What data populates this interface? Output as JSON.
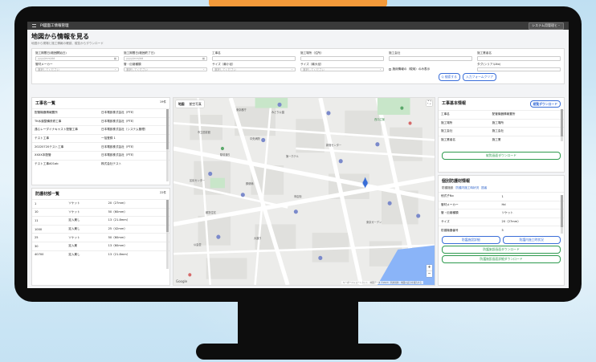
{
  "app": {
    "name": "PI図面工情報管理",
    "system_button": "システム用管理ヒ・"
  },
  "page": {
    "title": "地図から情報を見る",
    "subtitle": "地図から現場と施工情報の確認、縦覧からダウンロード"
  },
  "filters": {
    "row1": [
      {
        "label": "施工期間日(範囲開始日)",
        "value": "yyyy/mm/dd",
        "icon": "calendar-icon"
      },
      {
        "label": "施工期間日(範囲終了日)",
        "value": "yyyy/mm/dd",
        "icon": "calendar-icon"
      },
      {
        "label": "工事名",
        "value": ""
      },
      {
        "label": "施工場所（住所）",
        "value": ""
      },
      {
        "label": "施工会社",
        "value": ""
      },
      {
        "label": "施工業者名",
        "value": ""
      }
    ],
    "row2": [
      {
        "label": "管材メーカー",
        "value": "選択してください"
      },
      {
        "label": "管・伝継種類",
        "value": "選択してください"
      },
      {
        "label": "サイズ（最小径）",
        "value": "選択してください"
      },
      {
        "label": "サイズ（最大径）",
        "value": "選択してください"
      },
      {
        "label": "",
        "value": "",
        "checkbox": "施用情報の（現用）のみ表示"
      },
      {
        "label": "タグ(シリアルNo)",
        "value": ""
      }
    ],
    "search_button": "Q 検索する",
    "clear_button": "入力フォームクリア"
  },
  "project_list": {
    "title": "工事名一覧",
    "count": "19件",
    "rows": [
      [
        "配管機器情報置所",
        "日本電設株式会社（PTE）"
      ],
      [
        "TK水道整備改修工事",
        "日本電設株式会社（PTE）"
      ],
      [
        "遠心レーダイナキャスト配管工事",
        "日本電設株式会社（システム管理）"
      ],
      [
        "テスト工事",
        "一括登録 1"
      ],
      [
        "20220720テスト工事",
        "日本電設株式会社（PTE）"
      ],
      [
        "XXXX本配管",
        "日本電設株式会社（PTE）"
      ],
      [
        "テスト工事A01ab",
        "株式会社テスト"
      ]
    ]
  },
  "material_list": {
    "title": "防護材部一覧",
    "count": "22件",
    "rows": [
      [
        "1",
        "ソケット",
        "20（27mm）"
      ],
      [
        "10",
        "ソケット",
        "50（60mm）"
      ],
      [
        "11",
        "定入巣し",
        "13（21.8mm）"
      ],
      [
        "1000",
        "定入巣し",
        "25（42mm）"
      ],
      [
        "25",
        "ソケット",
        "50（60mm）"
      ],
      [
        "30",
        "定入巣",
        "13（60mm）"
      ],
      [
        "40700",
        "定入巣し",
        "13（21.8mm）"
      ]
    ]
  },
  "map": {
    "tab_map": "地図",
    "tab_satellite": "航空写真",
    "zoom_in": "+",
    "zoom_out": "−",
    "logo": "Google",
    "footer": "キーボードショートカット　地図データ ©2023　利用規約　地図の誤りを報告する",
    "labels": [
      "東京都庁",
      "みどり公園",
      "市立図書館",
      "中央病院",
      "駅前通り",
      "第一ホテル",
      "区民センター",
      "郵便局",
      "商店街",
      "都営住宅",
      "西口広場",
      "東京ガーデン",
      "大通り",
      "新宿センター",
      "公会堂"
    ]
  },
  "project_info": {
    "title": "工事基本情報",
    "download_button": "縦覧ダウンロード",
    "rows": [
      [
        "工事名",
        "配管機器情報置所"
      ],
      [
        "施工場所",
        "施工場所"
      ],
      [
        "施工会社",
        "施工会社"
      ],
      [
        "施工業者名",
        "施工業"
      ]
    ],
    "all_download": "縦覧画面ダウンロード"
  },
  "material_info": {
    "title": "個別防護材情報",
    "tabs": [
      "防護施設",
      "防護内施工時状況",
      "図者"
    ],
    "rows": [
      [
        "他式子No",
        "1"
      ],
      [
        "管材メーカー",
        "Hd"
      ],
      [
        "管・伝継種類",
        "ソケット"
      ],
      [
        "サイズ",
        "20（27mm）"
      ],
      [
        "防護機器番号",
        "5"
      ]
    ],
    "buttons": [
      "防護施設詳細",
      "防護内施工時状況"
    ],
    "download_1": "防護施設画面ダウンロード",
    "download_2": "防護施設画面詳細ダウンロード"
  }
}
